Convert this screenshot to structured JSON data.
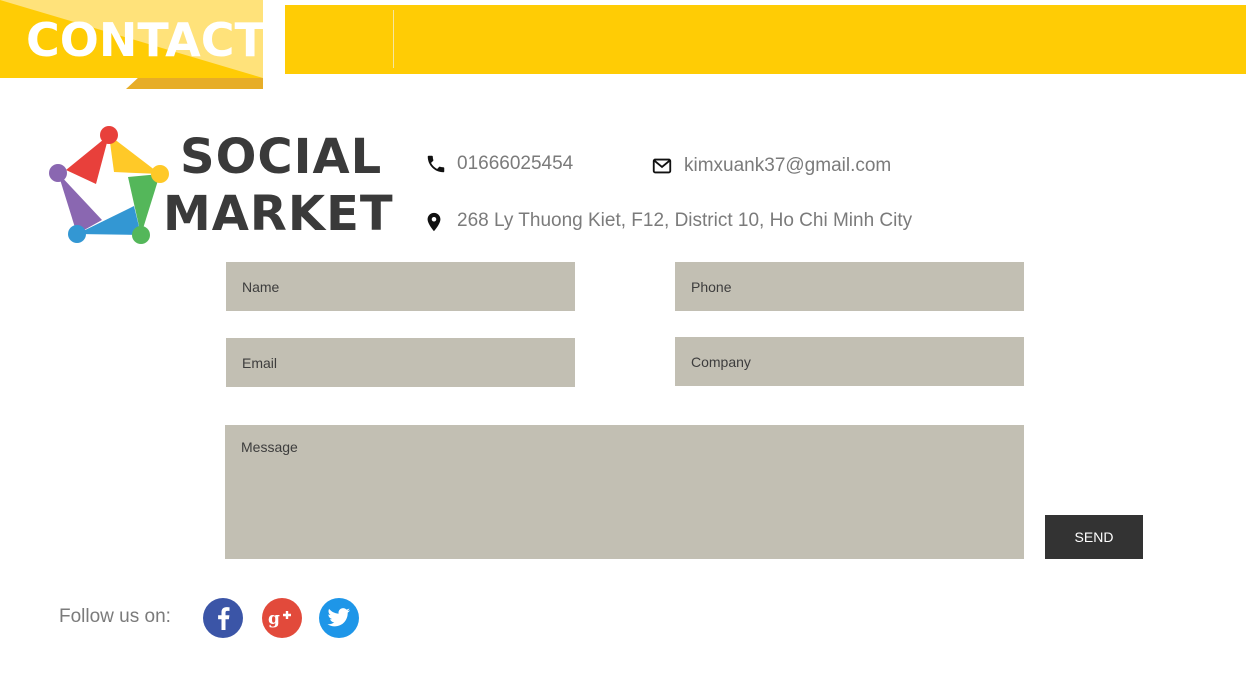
{
  "header": {
    "title": "CONTACT",
    "bar_color": "#ffcc05",
    "banner_colors": [
      "#ffe27a",
      "#ffcc05",
      "#e7ad27"
    ]
  },
  "brand": {
    "line1": "SOCIAL",
    "line2": "MARKET",
    "logo_colors": [
      "#e8403b",
      "#ffc928",
      "#54b75a",
      "#3397d3",
      "#8a67b1"
    ]
  },
  "contact_info": {
    "phone": "01666025454",
    "email": "kimxuank37@gmail.com",
    "address": "268 Ly Thuong Kiet, F12, District 10, Ho Chi Minh City",
    "icons": [
      "phone-icon",
      "mail-icon",
      "map-pin-icon"
    ]
  },
  "form": {
    "name_placeholder": "Name",
    "phone_placeholder": "Phone",
    "email_placeholder": "Email",
    "company_placeholder": "Company",
    "message_placeholder": "Message",
    "send_label": "SEND",
    "field_color": "#c2bfb3",
    "button_color": "#333333"
  },
  "social": {
    "label": "Follow us on:",
    "networks": [
      {
        "icon": "facebook-icon",
        "color": "#3b55a7"
      },
      {
        "icon": "google-plus-icon",
        "color": "#e24a3b"
      },
      {
        "icon": "twitter-icon",
        "color": "#1e96e8"
      }
    ]
  }
}
